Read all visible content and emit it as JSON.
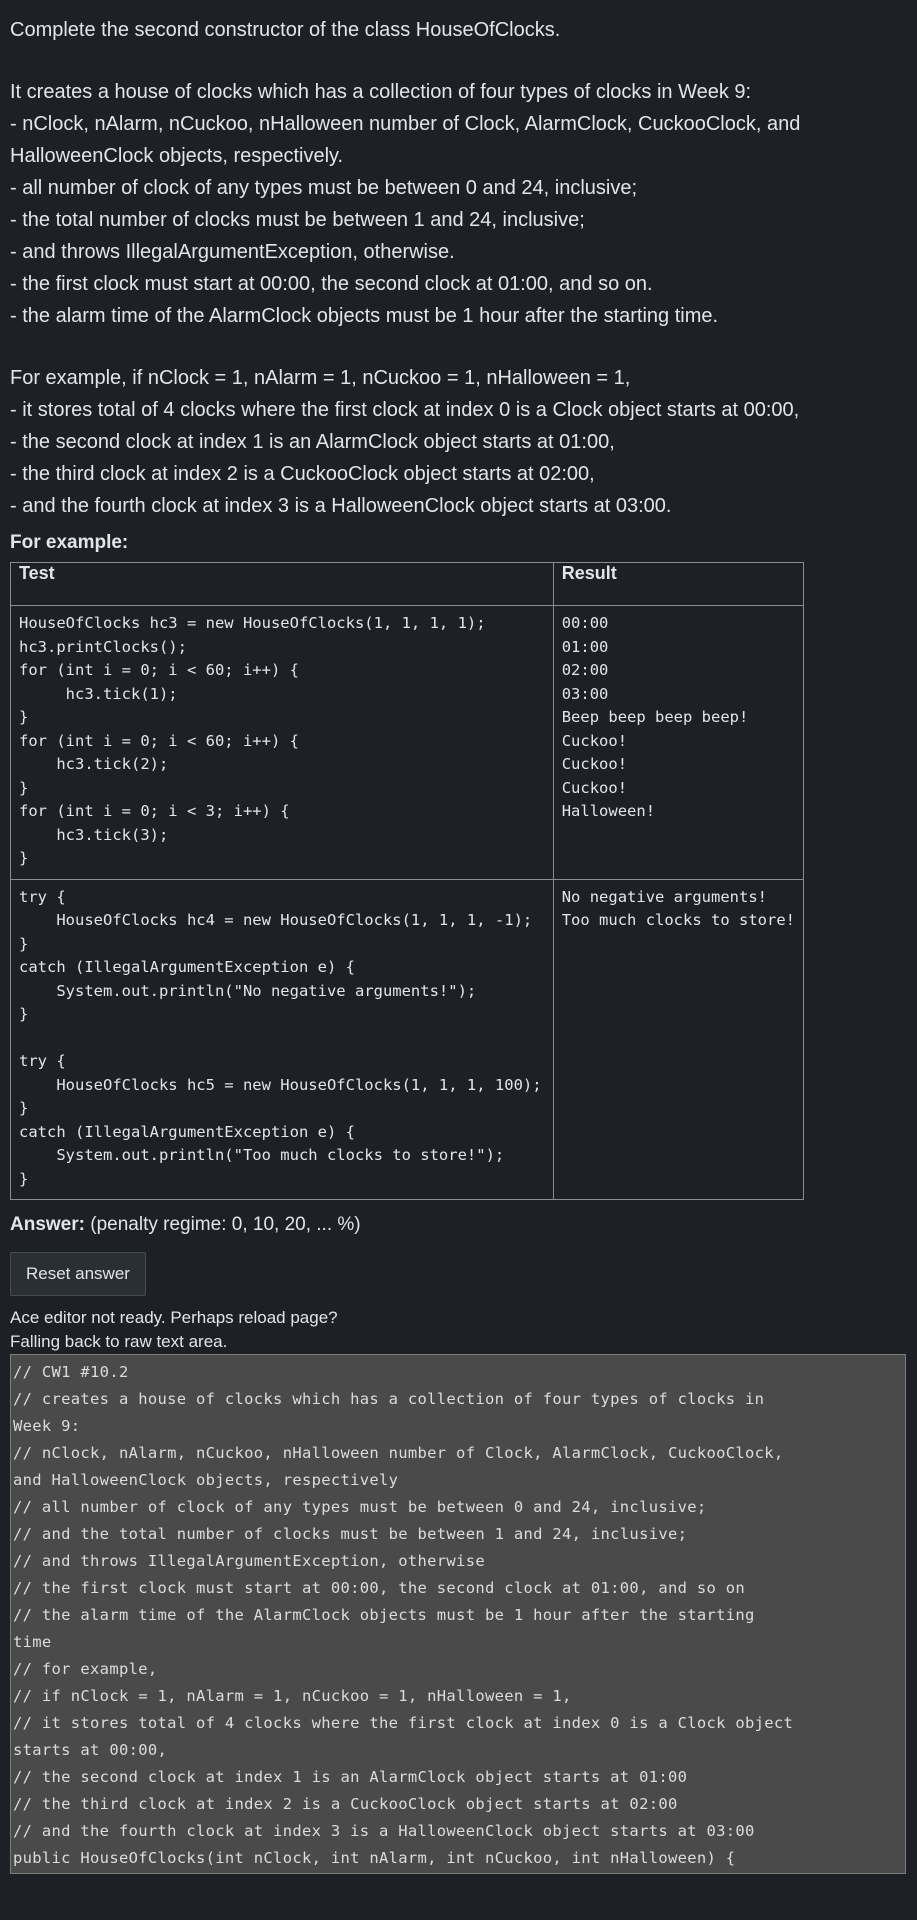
{
  "question": {
    "title": "Complete the second constructor of the class HouseOfClocks.",
    "desc": [
      "It creates a house of clocks which has a collection of four types of clocks in Week 9:",
      " - nClock, nAlarm, nCuckoo, nHalloween number of Clock, AlarmClock, CuckooClock, and",
      "HalloweenClock objects, respectively.",
      " - all number of clock of any types must be between 0 and 24, inclusive;",
      " - the total number of clocks must be between 1 and 24, inclusive;",
      " - and throws IllegalArgumentException, otherwise.",
      " - the first clock must start at 00:00, the second clock at 01:00, and so on.",
      " - the alarm time of the AlarmClock objects must be 1 hour after the starting time."
    ],
    "example": [
      "For example, if nClock = 1, nAlarm = 1, nCuckoo = 1, nHalloween = 1,",
      " - it stores total of 4 clocks where the first clock at index 0 is a Clock object starts at 00:00,",
      " - the second clock at index 1 is an AlarmClock object starts at 01:00,",
      " - the third clock at index 2 is a CuckooClock object starts at 02:00,",
      " - and the fourth clock at index 3 is a HalloweenClock object starts at 03:00."
    ]
  },
  "for_example_label": "For example:",
  "table": {
    "headers": [
      "Test",
      "Result"
    ],
    "rows": [
      {
        "test": "HouseOfClocks hc3 = new HouseOfClocks(1, 1, 1, 1);\nhc3.printClocks();\nfor (int i = 0; i < 60; i++) {\n     hc3.tick(1);\n}\nfor (int i = 0; i < 60; i++) {\n    hc3.tick(2);\n}\nfor (int i = 0; i < 3; i++) {\n    hc3.tick(3);\n}",
        "result": "00:00\n01:00\n02:00\n03:00\nBeep beep beep beep!\nCuckoo!\nCuckoo!\nCuckoo!\nHalloween!"
      },
      {
        "test": "try {\n    HouseOfClocks hc4 = new HouseOfClocks(1, 1, 1, -1);\n}\ncatch (IllegalArgumentException e) {\n    System.out.println(\"No negative arguments!\");\n}\n\ntry {\n    HouseOfClocks hc5 = new HouseOfClocks(1, 1, 1, 100);\n}\ncatch (IllegalArgumentException e) {\n    System.out.println(\"Too much clocks to store!\");\n}",
        "result": "No negative arguments!\nToo much clocks to store!"
      }
    ]
  },
  "answer": {
    "label": "Answer:",
    "penalty": "(penalty regime: 0, 10, 20, ... %)",
    "reset_label": "Reset answer",
    "note_line1": "Ace editor not ready. Perhaps reload page?",
    "note_line2": "Falling back to raw text area."
  },
  "editor_lines": [
    "// CW1 #10.2",
    "// creates a house of clocks which has a collection of four types of clocks in",
    "Week 9:",
    "// nClock, nAlarm, nCuckoo, nHalloween number of Clock, AlarmClock, CuckooClock,",
    "and HalloweenClock objects, respectively",
    "// all number of clock of any types must be between 0 and 24, inclusive;",
    "// and the total number of clocks must be between 1 and 24, inclusive;",
    "// and throws IllegalArgumentException, otherwise",
    "// the first clock must start at 00:00, the second clock at 01:00, and so on",
    "// the alarm time of the AlarmClock objects must be 1 hour after the starting",
    "time",
    "// for example,",
    "// if nClock = 1, nAlarm = 1, nCuckoo = 1, nHalloween = 1,",
    "// it stores total of 4 clocks where the first clock at index 0 is a Clock object",
    "starts at 00:00,",
    "// the second clock at index 1 is an AlarmClock object starts at 01:00",
    "// the third clock at index 2 is a CuckooClock object starts at 02:00",
    "// and the fourth clock at index 3 is a HalloweenClock object starts at 03:00",
    "public HouseOfClocks(int nClock, int nAlarm, int nCuckoo, int nHalloween) {"
  ]
}
